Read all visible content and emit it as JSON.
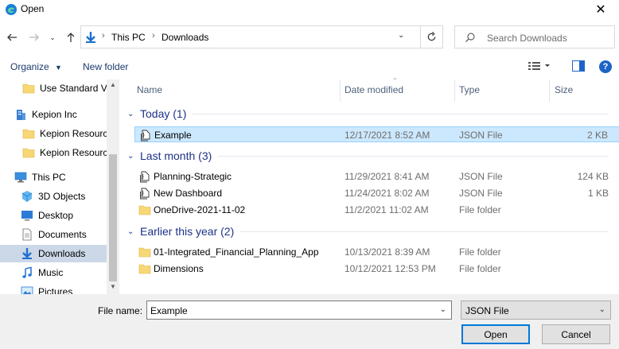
{
  "window": {
    "title": "Open"
  },
  "nav": {
    "breadcrumbs": [
      "This PC",
      "Downloads"
    ],
    "search_placeholder": "Search Downloads"
  },
  "toolbar": {
    "organize_label": "Organize",
    "new_folder_label": "New folder"
  },
  "sidebar": {
    "items": [
      {
        "label": "Use Standard Variables",
        "icon": "folder-icon",
        "selected": false
      },
      {
        "label": "Kepion Inc",
        "icon": "building-icon",
        "selected": false
      },
      {
        "label": "Kepion Resources",
        "icon": "folder-icon",
        "selected": false
      },
      {
        "label": "Kepion Resources",
        "icon": "folder-icon",
        "selected": false
      },
      {
        "label": "This PC",
        "icon": "computer-icon",
        "selected": false
      },
      {
        "label": "3D Objects",
        "icon": "cube-icon",
        "selected": false
      },
      {
        "label": "Desktop",
        "icon": "desktop-icon",
        "selected": false
      },
      {
        "label": "Documents",
        "icon": "document-icon",
        "selected": false
      },
      {
        "label": "Downloads",
        "icon": "download-icon",
        "selected": true
      },
      {
        "label": "Music",
        "icon": "music-icon",
        "selected": false
      },
      {
        "label": "Pictures",
        "icon": "picture-icon",
        "selected": false
      }
    ]
  },
  "columns": {
    "name": "Name",
    "date": "Date modified",
    "type": "Type",
    "size": "Size"
  },
  "groups": [
    {
      "label": "Today (1)",
      "files": [
        {
          "name": "Example",
          "date": "12/17/2021 8:52 AM",
          "type": "JSON File",
          "size": "2 KB",
          "icon": "json-file-icon",
          "selected": true
        }
      ]
    },
    {
      "label": "Last month (3)",
      "files": [
        {
          "name": "Planning-Strategic",
          "date": "11/29/2021 8:41 AM",
          "type": "JSON File",
          "size": "124 KB",
          "icon": "json-file-icon",
          "selected": false
        },
        {
          "name": "New Dashboard",
          "date": "11/24/2021 8:02 AM",
          "type": "JSON File",
          "size": "1 KB",
          "icon": "json-file-icon",
          "selected": false
        },
        {
          "name": "OneDrive-2021-11-02",
          "date": "11/2/2021 11:02 AM",
          "type": "File folder",
          "size": "",
          "icon": "folder-icon",
          "selected": false
        }
      ]
    },
    {
      "label": "Earlier this year (2)",
      "files": [
        {
          "name": "01-Integrated_Financial_Planning_App",
          "date": "10/13/2021 8:39 AM",
          "type": "File folder",
          "size": "",
          "icon": "folder-icon",
          "selected": false
        },
        {
          "name": "Dimensions",
          "date": "10/12/2021 12:53 PM",
          "type": "File folder",
          "size": "",
          "icon": "folder-icon",
          "selected": false
        }
      ]
    }
  ],
  "footer": {
    "file_name_label": "File name:",
    "file_name_value": "Example",
    "file_type_value": "JSON File",
    "open_label": "Open",
    "cancel_label": "Cancel"
  },
  "colors": {
    "accent": "#0078d7",
    "selected_row": "#cce8ff",
    "group_header": "#1e3287"
  }
}
